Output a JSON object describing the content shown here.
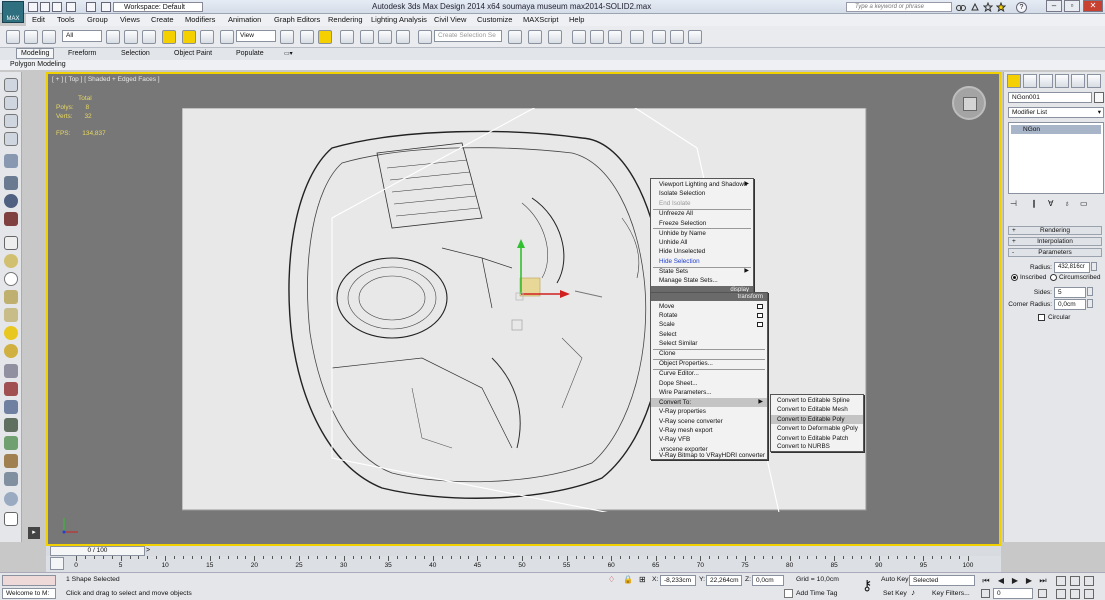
{
  "titlebar": {
    "app_logo": "MAX",
    "workspace": "Workspace: Default",
    "title": "Autodesk 3ds Max Design 2014 x64     soumaya museum max2014-SOLID2.max",
    "search_placeholder": "Type a keyword or phrase"
  },
  "menus": [
    "Edit",
    "Tools",
    "Group",
    "Views",
    "Create",
    "Modifiers",
    "Animation",
    "Graph Editors",
    "Rendering",
    "Lighting Analysis",
    "Civil View",
    "Customize",
    "MAXScript",
    "Help"
  ],
  "toolbar": {
    "selection_filter": "All",
    "reference_coord": "View",
    "named_selection_placeholder": "Create Selection Se"
  },
  "ribbon": {
    "tabs": [
      "Modeling",
      "Freeform",
      "Selection",
      "Object Paint",
      "Populate"
    ],
    "active_tab": "Modeling",
    "subpanel": "Polygon Modeling"
  },
  "viewport": {
    "label": "[ + ] [ Top ] [ Shaded + Edged Faces ]",
    "stats": {
      "total_label": "Total",
      "polys_label": "Polys:",
      "polys_value": "8",
      "verts_label": "Verts:",
      "verts_value": "32",
      "fps_label": "FPS:",
      "fps_value": "134,837"
    }
  },
  "quad_menu": {
    "display_items": [
      "Viewport Lighting and Shadows",
      "Isolate Selection",
      "End Isolate",
      "Unfreeze All",
      "Freeze Selection",
      "Unhide by Name",
      "Unhide All",
      "Hide Unselected",
      "Hide Selection",
      "State Sets",
      "Manage State Sets..."
    ],
    "display_header": "display",
    "transform_header": "transform",
    "transform_items": [
      "Move",
      "Rotate",
      "Scale",
      "Select",
      "Select Similar",
      "Clone",
      "Object Properties...",
      "Curve Editor...",
      "Dope Sheet...",
      "Wire Parameters...",
      "Convert To:",
      "V-Ray properties",
      "V-Ray scene converter",
      "V-Ray mesh export",
      "V-Ray VFB",
      ".vrscene exporter",
      "V-Ray Bitmap to VRayHDRI converter"
    ],
    "convert_submenu": [
      "Convert to Editable Spline",
      "Convert to Editable Mesh",
      "Convert to Editable Poly",
      "Convert to Deformable gPoly",
      "Convert to Editable Patch",
      "Convert to NURBS"
    ],
    "highlighted": "Convert to Editable Poly"
  },
  "command_panel": {
    "object_name": "NGon001",
    "modifier_list": "Modifier List",
    "stack_item": "NGon",
    "rollouts": [
      "Rendering",
      "Interpolation",
      "Parameters"
    ],
    "radius_label": "Radius:",
    "radius_value": "432,816cr",
    "inscribed_label": "Inscribed",
    "circumscribed_label": "Circumscribed",
    "sides_label": "Sides:",
    "sides_value": "5",
    "corner_radius_label": "Corner Radius:",
    "corner_radius_value": "0,0cm",
    "circular_label": "Circular"
  },
  "timeline": {
    "frame": "0 / 100",
    "ticks": [
      "0",
      "5",
      "10",
      "15",
      "20",
      "25",
      "30",
      "35",
      "40",
      "45",
      "50",
      "55",
      "60",
      "65",
      "70",
      "75",
      "80",
      "85",
      "90",
      "95",
      "100"
    ]
  },
  "statusbar": {
    "welcome": "Welcome to M:",
    "selection_status": "1 Shape Selected",
    "prompt": "Click and drag to select and move objects",
    "x_label": "X:",
    "x_value": "-8,233cm",
    "y_label": "Y:",
    "y_value": "22,264cm",
    "z_label": "Z:",
    "z_value": "0,0cm",
    "grid": "Grid = 10,0cm",
    "add_time_tag": "Add Time Tag",
    "auto_key": "Auto Key",
    "set_key": "Set Key",
    "key_mode": "Selected",
    "key_filters": "Key Filters...",
    "frame_value": "0"
  }
}
